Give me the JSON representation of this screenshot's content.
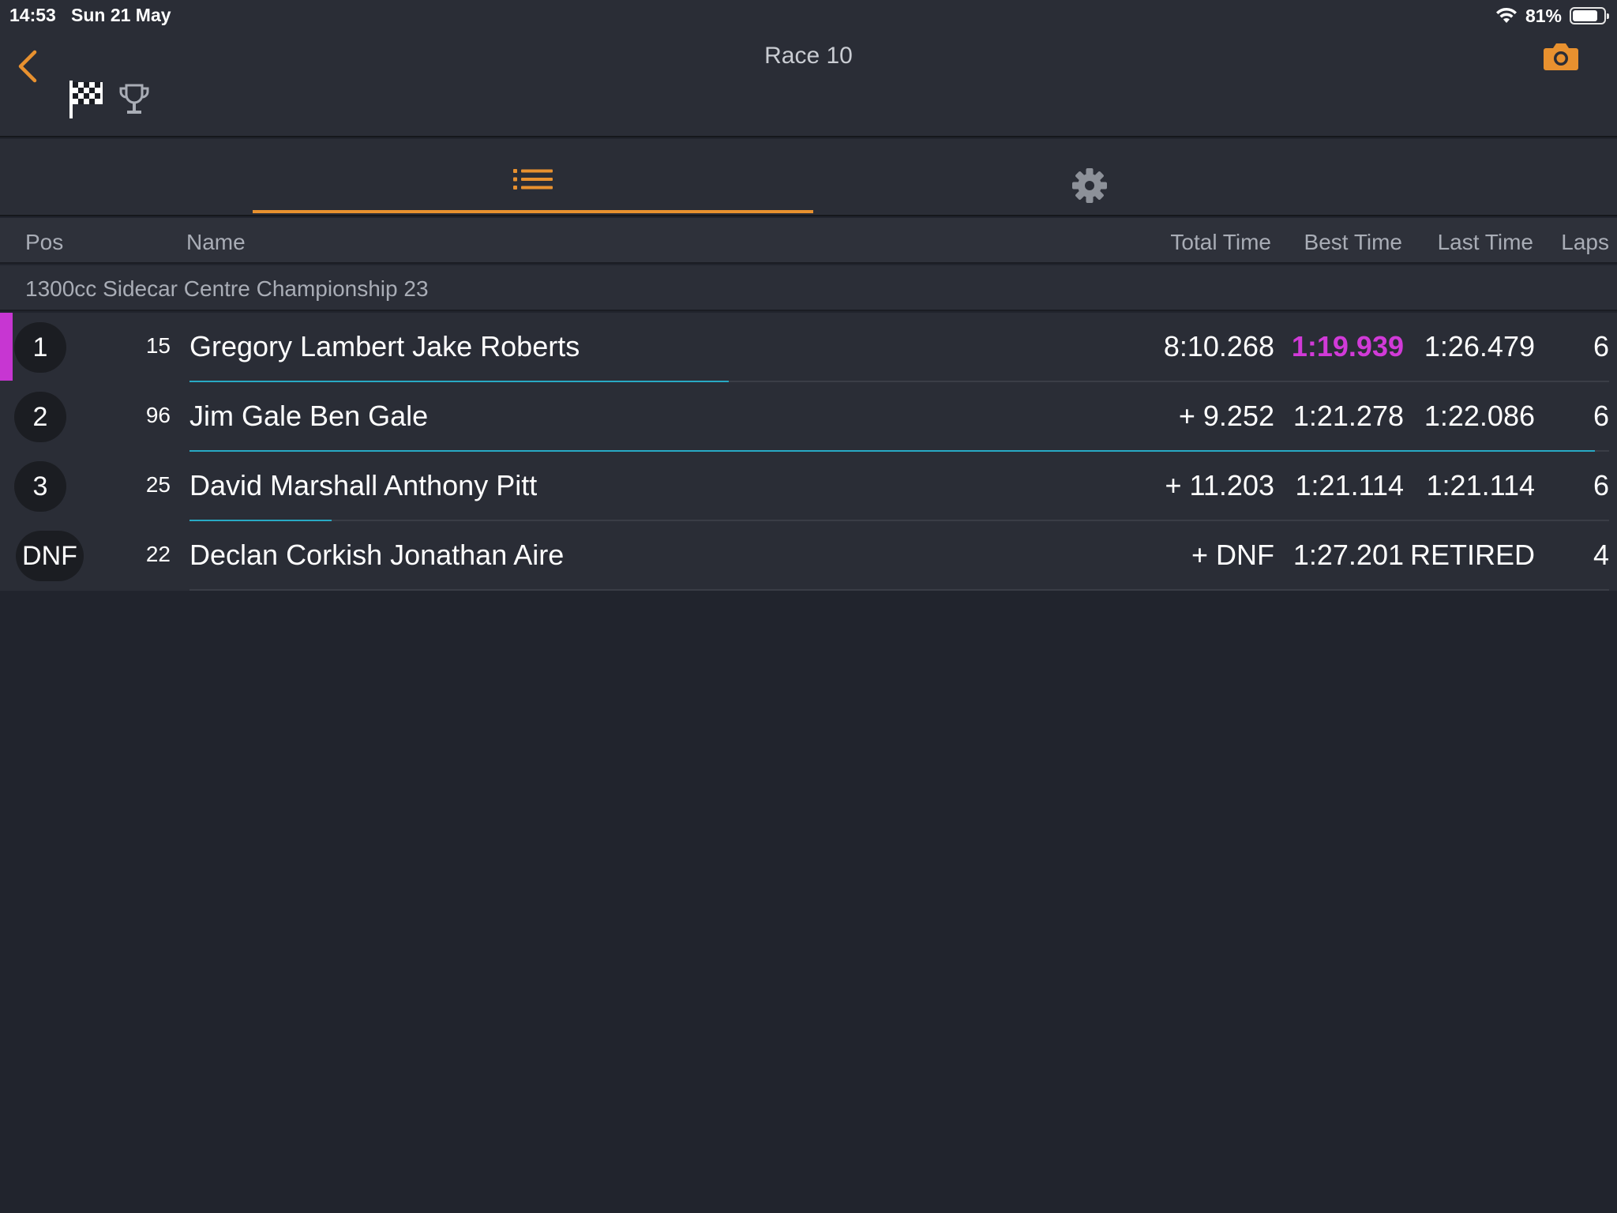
{
  "status_bar": {
    "time": "14:53",
    "date": "Sun 21 May",
    "battery_percent": "81%",
    "battery_level": 0.81
  },
  "header": {
    "title": "Race 10",
    "back_icon": "chevron-left-icon",
    "camera_icon": "camera-icon",
    "flag_icon": "checkered-flag-icon",
    "trophy_icon": "trophy-icon",
    "accent_color": "#e8912f"
  },
  "tabs": [
    {
      "icon": "list-icon",
      "active": true
    },
    {
      "icon": "gear-icon",
      "active": false
    }
  ],
  "columns": {
    "pos": "Pos",
    "name": "Name",
    "total": "Total Time",
    "best": "Best Time",
    "last": "Last Time",
    "laps": "Laps"
  },
  "group": {
    "title": "1300cc Sidecar Centre Championship 23"
  },
  "results": [
    {
      "pos": "1",
      "bib": "15",
      "name": "Gregory Lambert Jake Roberts",
      "total": "8:10.268",
      "best": "1:19.939",
      "last": "1:26.479",
      "laps": "6",
      "fastest": true,
      "progress": 0.38
    },
    {
      "pos": "2",
      "bib": "96",
      "name": "Jim Gale Ben Gale",
      "total": "+ 9.252",
      "best": "1:21.278",
      "last": "1:22.086",
      "laps": "6",
      "fastest": false,
      "progress": 0.99
    },
    {
      "pos": "3",
      "bib": "25",
      "name": "David Marshall Anthony Pitt",
      "total": "+ 11.203",
      "best": "1:21.114",
      "last": "1:21.114",
      "laps": "6",
      "fastest": false,
      "progress": 0.1
    },
    {
      "pos": "DNF",
      "bib": "22",
      "name": "Declan Corkish Jonathan Aire",
      "total": "+ DNF",
      "best": "1:27.201",
      "last": "RETIRED",
      "laps": "4",
      "fastest": false,
      "progress": 0
    }
  ],
  "colors": {
    "fastest_lap": "#d13ad8",
    "progress": "#28a9c4",
    "background": "#21242d"
  }
}
